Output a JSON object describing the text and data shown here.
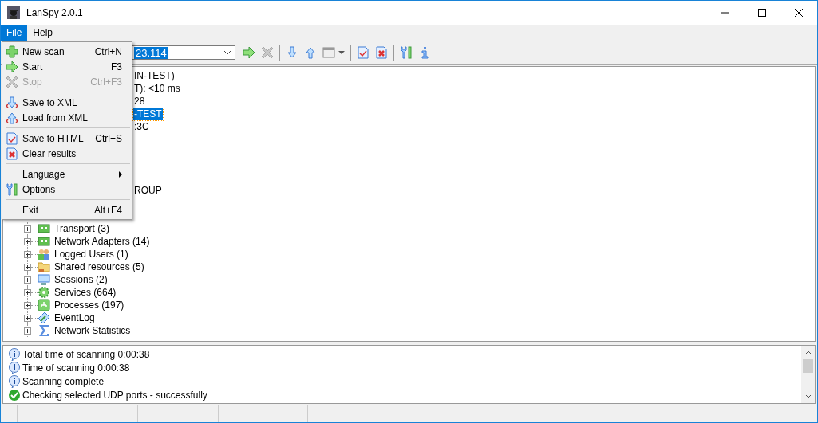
{
  "window": {
    "title": "LanSpy 2.0.1"
  },
  "menubar": [
    {
      "label": "File",
      "selected": true
    },
    {
      "label": "Help",
      "selected": false
    }
  ],
  "file_menu": [
    {
      "kind": "item",
      "label": "New scan",
      "shortcut": "Ctrl+N",
      "disabled": false
    },
    {
      "kind": "item",
      "label": "Start",
      "shortcut": "F3",
      "disabled": false
    },
    {
      "kind": "item",
      "label": "Stop",
      "shortcut": "Ctrl+F3",
      "disabled": true
    },
    {
      "kind": "separator"
    },
    {
      "kind": "item",
      "label": "Save to XML",
      "disabled": false
    },
    {
      "kind": "item",
      "label": "Load from XML",
      "disabled": false
    },
    {
      "kind": "separator"
    },
    {
      "kind": "item",
      "label": "Save to HTML",
      "shortcut": "Ctrl+S",
      "disabled": false
    },
    {
      "kind": "item",
      "label": "Clear results",
      "disabled": false
    },
    {
      "kind": "separator"
    },
    {
      "kind": "submenu",
      "label": "Language",
      "disabled": false
    },
    {
      "kind": "item",
      "label": "Options",
      "disabled": false
    },
    {
      "kind": "separator"
    },
    {
      "kind": "item",
      "label": "Exit",
      "shortcut": "Alt+F4",
      "disabled": false
    }
  ],
  "toolbar": {
    "address": "23.114",
    "buttons": [
      {
        "kind": "button",
        "disabled": false
      },
      {
        "kind": "button",
        "disabled": true
      },
      {
        "kind": "separator"
      },
      {
        "kind": "button",
        "disabled": false
      },
      {
        "kind": "button",
        "disabled": false
      },
      {
        "kind": "button",
        "disabled": false
      },
      {
        "kind": "separator"
      },
      {
        "kind": "button",
        "disabled": false
      },
      {
        "kind": "button",
        "disabled": false
      },
      {
        "kind": "separator"
      },
      {
        "kind": "button",
        "disabled": false
      },
      {
        "kind": "button",
        "disabled": false
      }
    ]
  },
  "tree": [
    {
      "kind": "partial",
      "label": "IN-TEST)",
      "selected": false
    },
    {
      "kind": "partial",
      "label": "T): <10 ms",
      "selected": false
    },
    {
      "kind": "partial",
      "label": "28",
      "selected": false
    },
    {
      "kind": "partial",
      "label": "-TEST",
      "selected": true
    },
    {
      "kind": "partial",
      "label": ":3C",
      "selected": false
    },
    {
      "kind": "covered"
    },
    {
      "kind": "covered"
    },
    {
      "kind": "covered"
    },
    {
      "kind": "covered"
    },
    {
      "kind": "partial",
      "label": "ROUP",
      "selected": false
    },
    {
      "kind": "covered"
    },
    {
      "kind": "covered"
    },
    {
      "kind": "node",
      "label": "Transport (3)",
      "selected": false
    },
    {
      "kind": "node",
      "label": "Network Adapters (14)",
      "selected": false
    },
    {
      "kind": "node",
      "label": "Logged Users (1)",
      "selected": false
    },
    {
      "kind": "node",
      "label": "Shared resources (5)",
      "selected": false
    },
    {
      "kind": "node",
      "label": "Sessions (2)",
      "selected": false
    },
    {
      "kind": "node",
      "label": "Services (664)",
      "selected": false
    },
    {
      "kind": "node",
      "label": "Processes (197)",
      "selected": false
    },
    {
      "kind": "node",
      "label": "EventLog",
      "selected": false
    },
    {
      "kind": "node",
      "label": "Network Statistics",
      "selected": false
    }
  ],
  "log": [
    {
      "kind": "info",
      "text": "Total time of scanning 0:00:38"
    },
    {
      "kind": "info",
      "text": "Time of scanning 0:00:38"
    },
    {
      "kind": "info",
      "text": "Scanning complete"
    },
    {
      "kind": "success",
      "text": "Checking selected UDP ports - successfully"
    }
  ]
}
